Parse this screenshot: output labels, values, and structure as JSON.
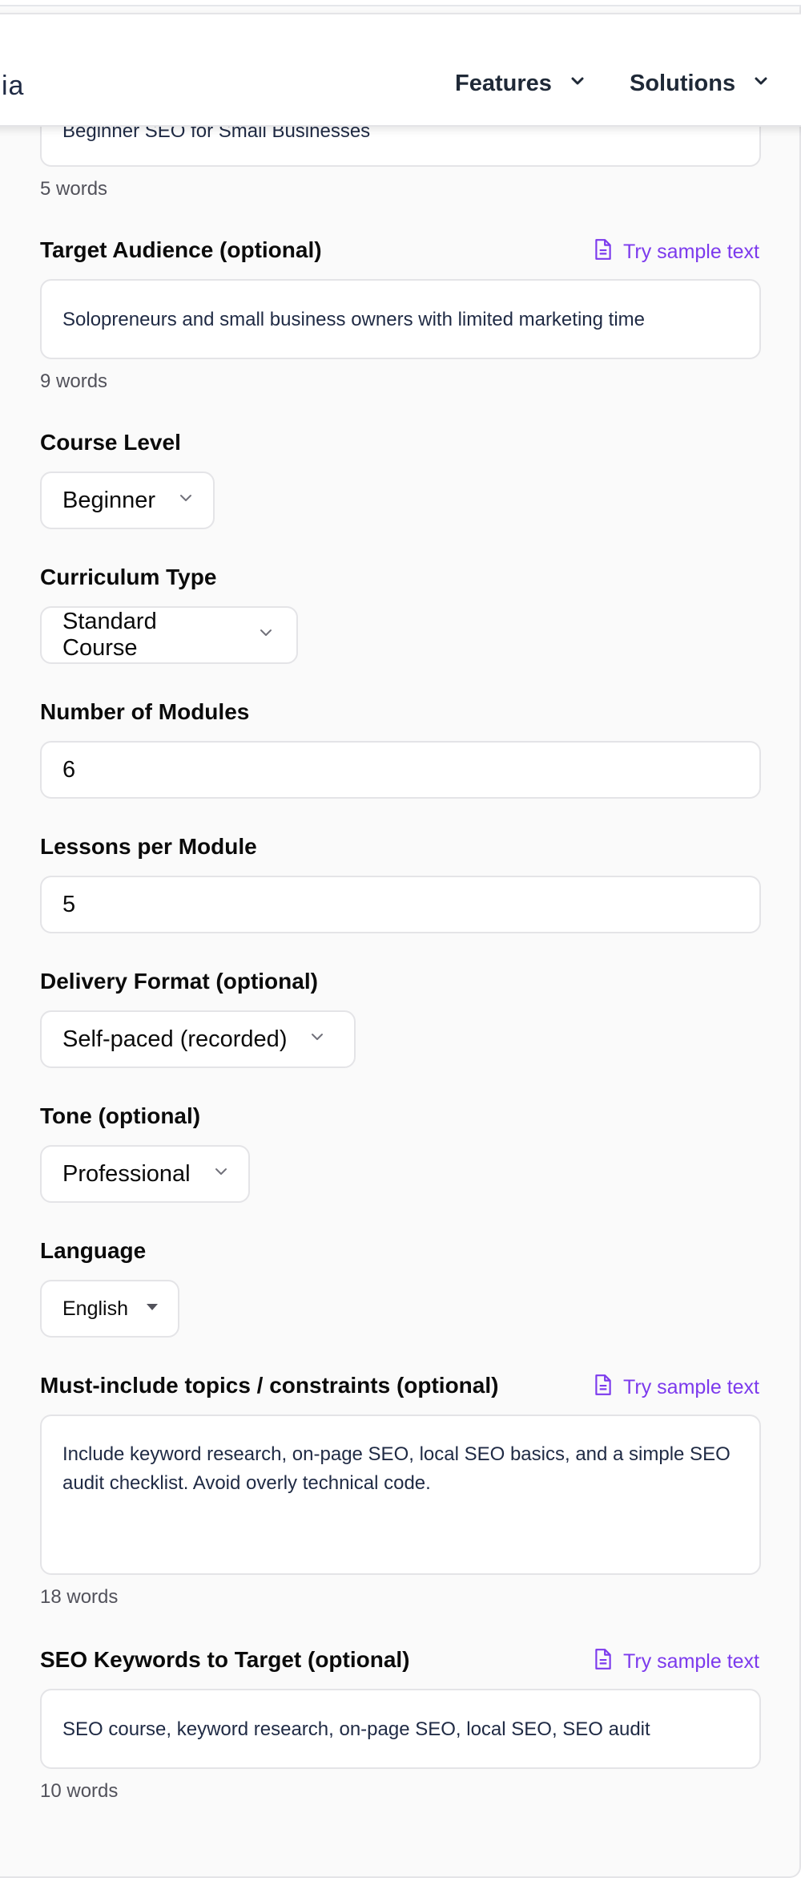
{
  "nav": {
    "logo_fragment": "ia",
    "items": [
      {
        "label": "Features"
      },
      {
        "label": "Solutions"
      }
    ]
  },
  "course_title": {
    "value": "Beginner SEO for Small Businesses",
    "word_count": "5 words"
  },
  "target_audience": {
    "label": "Target Audience (optional)",
    "sample_link": "Try sample text",
    "value": "Solopreneurs and small business owners with limited marketing time",
    "word_count": "9 words"
  },
  "course_level": {
    "label": "Course Level",
    "selected": "Beginner"
  },
  "curriculum_type": {
    "label": "Curriculum Type",
    "selected": "Standard Course"
  },
  "number_of_modules": {
    "label": "Number of Modules",
    "value": "6"
  },
  "lessons_per_module": {
    "label": "Lessons per Module",
    "value": "5"
  },
  "delivery_format": {
    "label": "Delivery Format (optional)",
    "selected": "Self-paced (recorded)"
  },
  "tone": {
    "label": "Tone (optional)",
    "selected": "Professional"
  },
  "language": {
    "label": "Language",
    "selected": "English"
  },
  "must_include": {
    "label": "Must-include topics / constraints (optional)",
    "sample_link": "Try sample text",
    "value": "Include keyword research, on-page SEO, local SEO basics, and a simple SEO audit checklist. Avoid overly technical code.",
    "word_count": "18 words"
  },
  "seo_keywords": {
    "label": "SEO Keywords to Target (optional)",
    "sample_link": "Try sample text",
    "value": "SEO course, keyword research, on-page SEO, local SEO, SEO audit",
    "word_count": "10 words"
  },
  "colors": {
    "accent": "#7c3aed",
    "text": "#0b0b0b",
    "muted": "#52525b",
    "border": "#e4e4e7",
    "background": "#fafafa"
  },
  "icons": [
    "chevron-down-icon",
    "document-icon",
    "caret-down-icon"
  ]
}
